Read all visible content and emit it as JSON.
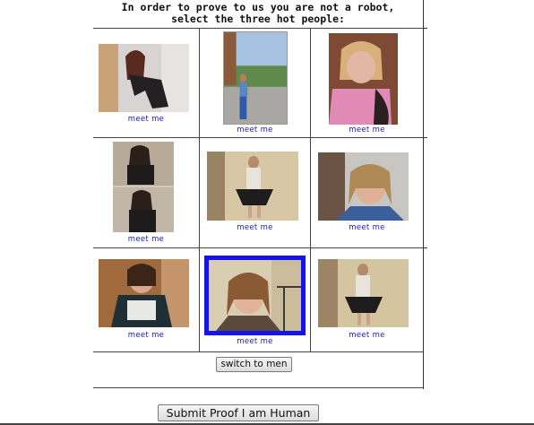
{
  "captcha": {
    "title_line1": "In order to prove to us you are not a robot,",
    "title_line2": "select the three hot people:",
    "photos": [
      {
        "label": "meet me",
        "selected": false
      },
      {
        "label": "meet me",
        "selected": false
      },
      {
        "label": "meet me",
        "selected": false
      },
      {
        "label": "meet me",
        "selected": false
      },
      {
        "label": "meet me",
        "selected": false
      },
      {
        "label": "meet me",
        "selected": false
      },
      {
        "label": "meet me",
        "selected": false
      },
      {
        "label": "meet me",
        "selected": true
      },
      {
        "label": "meet me",
        "selected": false
      }
    ],
    "switch_label": "switch to men"
  },
  "form": {
    "submit_label": "Submit Proof I am Human"
  },
  "colors": {
    "link": "#1a1ab5",
    "selection_border": "#1414e6"
  }
}
